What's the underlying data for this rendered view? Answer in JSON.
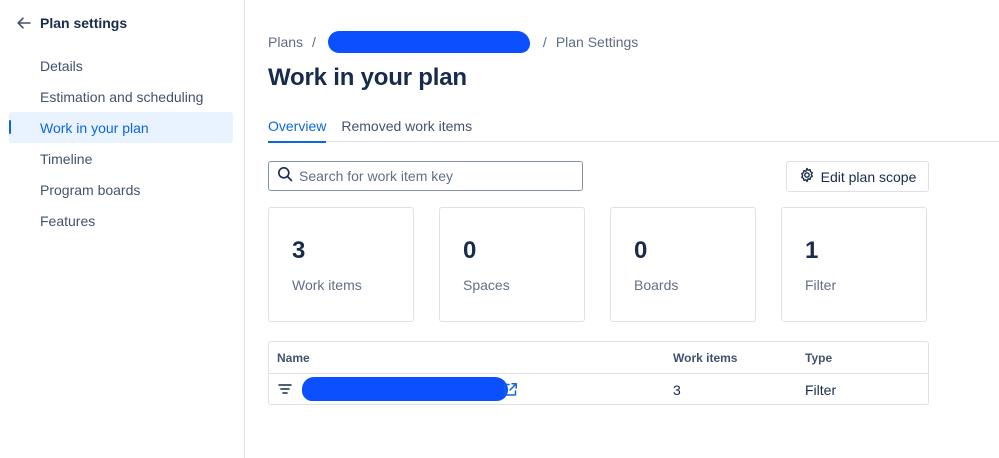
{
  "sidebar": {
    "back_title": "Plan settings",
    "items": [
      {
        "label": "Details"
      },
      {
        "label": "Estimation and scheduling"
      },
      {
        "label": "Work in your plan",
        "active": true
      },
      {
        "label": "Timeline"
      },
      {
        "label": "Program boards"
      },
      {
        "label": "Features"
      }
    ]
  },
  "breadcrumb": {
    "root": "Plans",
    "separator": "/",
    "current": "Plan Settings"
  },
  "page": {
    "title": "Work in your plan"
  },
  "tabs": [
    {
      "label": "Overview",
      "active": true
    },
    {
      "label": "Removed work items",
      "active": false
    }
  ],
  "search": {
    "placeholder": "Search for work item key",
    "value": ""
  },
  "edit_scope_button": {
    "label": "Edit plan scope",
    "icon": "gear-icon"
  },
  "stats": [
    {
      "value": "3",
      "label": "Work items"
    },
    {
      "value": "0",
      "label": "Spaces"
    },
    {
      "value": "0",
      "label": "Boards"
    },
    {
      "value": "1",
      "label": "Filter"
    }
  ],
  "table": {
    "headers": {
      "name": "Name",
      "work_items": "Work items",
      "type": "Type"
    },
    "rows": [
      {
        "work_items": "3",
        "type": "Filter",
        "icon": "filter-icon"
      }
    ]
  },
  "colors": {
    "accent": "#0c66e4",
    "active_bg": "#e9f2ff",
    "redaction": "#0b4fff",
    "border": "#dfe1e6"
  }
}
